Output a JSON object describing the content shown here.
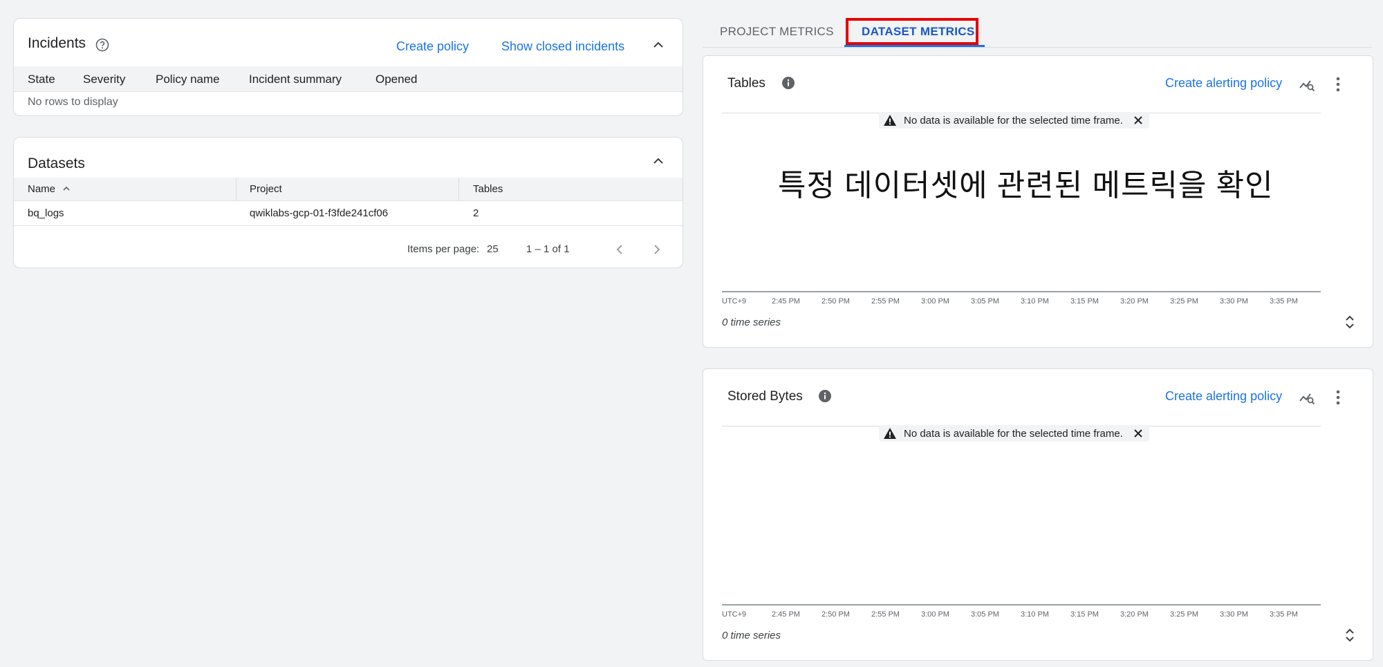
{
  "incidents": {
    "title": "Incidents",
    "create_policy": "Create policy",
    "show_closed": "Show closed incidents",
    "columns": [
      "State",
      "Severity",
      "Policy name",
      "Incident summary",
      "Opened"
    ],
    "empty_text": "No rows to display"
  },
  "datasets": {
    "title": "Datasets",
    "columns": [
      "Name",
      "Project",
      "Tables"
    ],
    "rows": [
      {
        "name": "bq_logs",
        "project": "qwiklabs-gcp-01-f3fde241cf06",
        "tables": "2"
      }
    ],
    "items_per_page_label": "Items per page:",
    "items_per_page_value": "25",
    "range_label": "1 – 1 of 1"
  },
  "tabs": {
    "project": "PROJECT METRICS",
    "dataset": "DATASET METRICS",
    "active": "dataset"
  },
  "charts": [
    {
      "title": "Tables",
      "alert_link": "Create alerting policy",
      "no_data": "No data is available for the selected time frame.",
      "x_ticks": [
        "UTC+9",
        "2:45 PM",
        "2:50 PM",
        "2:55 PM",
        "3:00 PM",
        "3:05 PM",
        "3:10 PM",
        "3:15 PM",
        "3:20 PM",
        "3:25 PM",
        "3:30 PM",
        "3:35 PM"
      ],
      "series_count": "0 time series"
    },
    {
      "title": "Stored Bytes",
      "alert_link": "Create alerting policy",
      "no_data": "No data is available for the selected time frame.",
      "x_ticks": [
        "UTC+9",
        "2:45 PM",
        "2:50 PM",
        "2:55 PM",
        "3:00 PM",
        "3:05 PM",
        "3:10 PM",
        "3:15 PM",
        "3:20 PM",
        "3:25 PM",
        "3:30 PM",
        "3:35 PM"
      ],
      "series_count": "0 time series"
    }
  ],
  "annotation": "특정 데이터셋에 관련된 메트릭을 확인",
  "colors": {
    "link": "#1a73e8",
    "highlight": "#e50000",
    "background": "#f1f3f4"
  }
}
